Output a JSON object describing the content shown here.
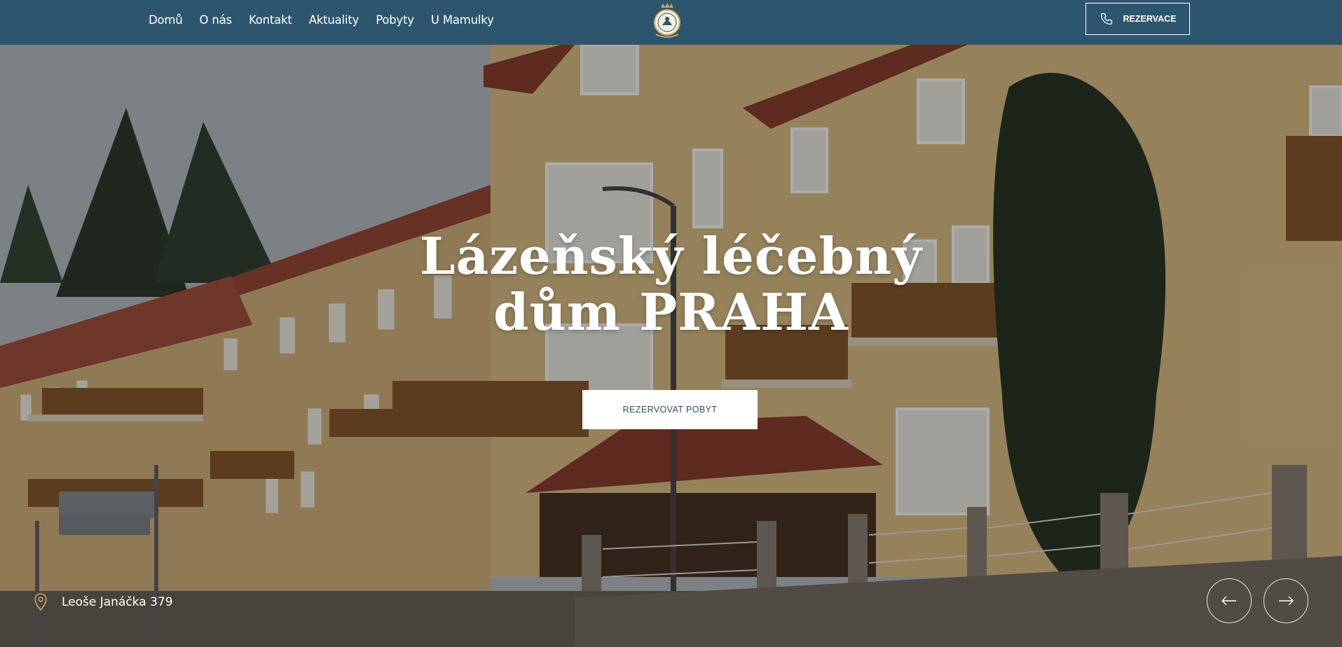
{
  "nav": {
    "items": [
      "Domů",
      "O nás",
      "Kontakt",
      "Aktuality",
      "Pobyty",
      "U Mamulky"
    ]
  },
  "header": {
    "logo_icon": "crest-logo-icon",
    "reserve_label": "REZERVACE",
    "reserve_icon": "phone-icon"
  },
  "hero": {
    "title_line1": "Lázeňský léčebný",
    "title_line2": "dům PRAHA",
    "cta_label": "REZERVOVAT POBYT",
    "address": "Leoše Janáčka 379",
    "address_icon": "map-pin-icon",
    "prev_icon": "arrow-left-icon",
    "next_icon": "arrow-right-icon"
  },
  "colors": {
    "header_bg": "#2d566e",
    "accent": "#c8a85a",
    "cta_text": "#2d4c5c"
  }
}
